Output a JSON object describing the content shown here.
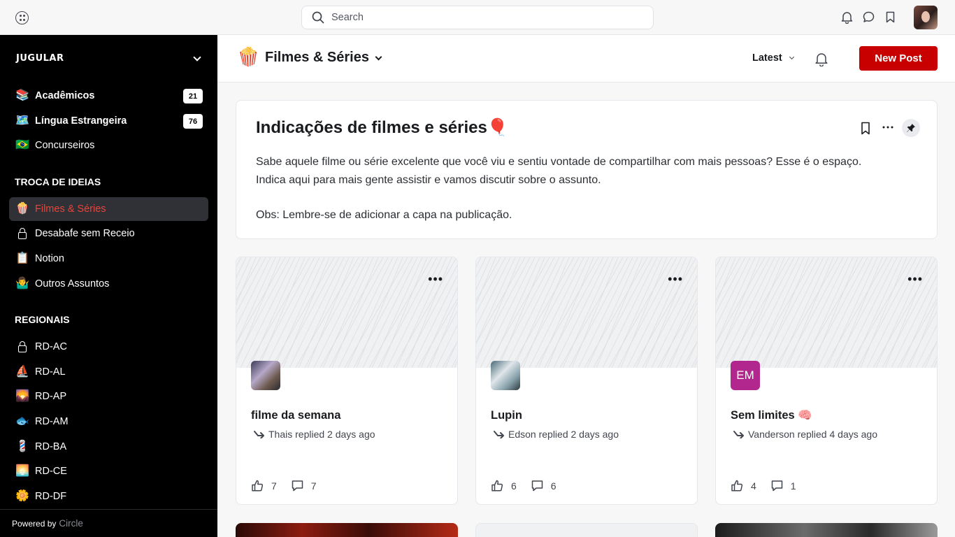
{
  "topbar": {
    "search_placeholder": "Search"
  },
  "sidebar": {
    "community_name": "JUGULAR",
    "pinned": [
      {
        "icon": "📚",
        "label": "Acadêmicos",
        "badge": "21"
      },
      {
        "icon": "🗺️",
        "label": "Língua Estrangeira",
        "badge": "76"
      },
      {
        "icon": "🇧🇷",
        "label": "Concurseiros"
      }
    ],
    "section_ideas": "TROCA DE IDEIAS",
    "ideas": [
      {
        "icon": "🍿",
        "label": "Filmes & Séries",
        "active": true
      },
      {
        "icon": "lock-icon",
        "label": "Desabafe sem Receio"
      },
      {
        "icon": "📋",
        "label": "Notion"
      },
      {
        "icon": "🤷‍♂️",
        "label": "Outros Assuntos"
      }
    ],
    "section_regionais": "REGIONAIS",
    "regionais": [
      {
        "icon": "lock-icon",
        "label": "RD-AC"
      },
      {
        "icon": "⛵",
        "label": "RD-AL"
      },
      {
        "icon": "🌄",
        "label": "RD-AP"
      },
      {
        "icon": "🐟",
        "label": "RD-AM"
      },
      {
        "icon": "💈",
        "label": "RD-BA"
      },
      {
        "icon": "🌅",
        "label": "RD-CE"
      },
      {
        "icon": "🌼",
        "label": "RD-DF"
      }
    ],
    "powered_by": "Powered by",
    "powered_brand": "Circle"
  },
  "header": {
    "space_icon": "🍿",
    "space_title": "Filmes & Séries",
    "sort_label": "Latest",
    "new_post_label": "New Post"
  },
  "info_card": {
    "title": "Indicações de filmes e séries🎈",
    "line1": "Sabe aquele filme ou série excelente que você viu e sentiu vontade de compartilhar com mais pessoas? Esse é o espaço.",
    "line2": "Indica aqui para mais gente assistir e vamos discutir sobre o assunto.",
    "line3": "Obs: Lembre-se de adicionar a capa na publicação."
  },
  "posts": [
    {
      "title": "filme da semana",
      "reply": "Thais replied 2 days ago",
      "likes": "7",
      "comments": "7",
      "avatar": "photo"
    },
    {
      "title": "Lupin",
      "reply": "Edson replied 2 days ago",
      "likes": "6",
      "comments": "6",
      "avatar": "photo"
    },
    {
      "title": "Sem limites 🧠",
      "reply": "Vanderson replied 4 days ago",
      "likes": "4",
      "comments": "1",
      "avatar_initials": "EM"
    }
  ],
  "colors": {
    "brand_red": "#c90000",
    "active_text": "#e8443a",
    "sidebar_bg": "#000000",
    "avatar_em": "#b2278d"
  }
}
